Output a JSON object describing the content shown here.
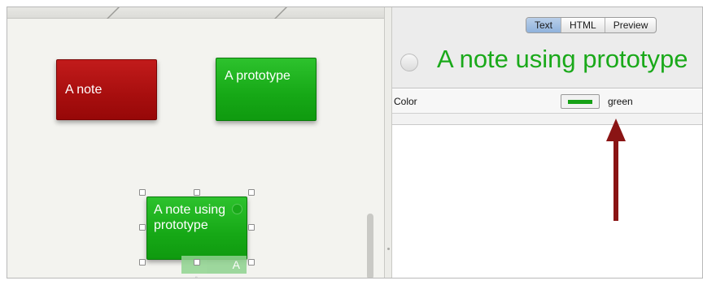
{
  "canvas": {
    "notes": [
      {
        "label": "A note",
        "color": "#a70e0e"
      },
      {
        "label": "A prototype",
        "color": "#16a816"
      },
      {
        "label": "A note using prototype",
        "color": "#16a816"
      }
    ],
    "ghost_label": "A"
  },
  "inspector": {
    "tabs": [
      {
        "label": "Text",
        "active": true
      },
      {
        "label": "HTML",
        "active": false
      },
      {
        "label": "Preview",
        "active": false
      }
    ],
    "note_title": "A note using prototype",
    "note_title_color": "#1aa91a",
    "attributes": [
      {
        "name": "Color",
        "value": "green",
        "swatch_color": "#16a116"
      }
    ]
  },
  "annotation": {
    "arrow_color": "#8a1414",
    "icon": "up-arrow-icon"
  }
}
